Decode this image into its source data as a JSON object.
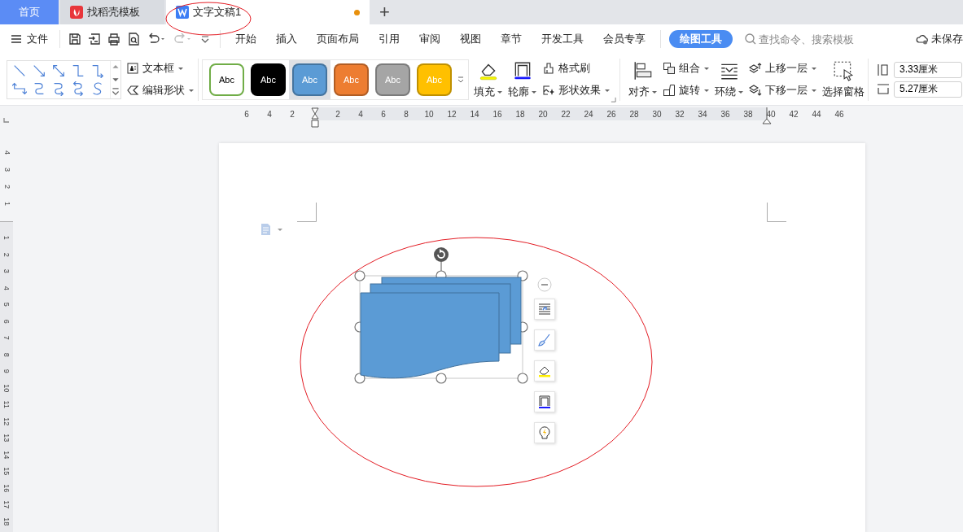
{
  "tabs": [
    {
      "label": "首页",
      "kind": "home",
      "selected": false
    },
    {
      "label": "找稻壳模板",
      "kind": "template",
      "selected": false
    },
    {
      "label": "文字文稿1",
      "kind": "document",
      "selected": true,
      "unsaved": true
    }
  ],
  "new_tab": "+",
  "menu": {
    "file": "文件",
    "tabs": [
      {
        "label": "开始",
        "selected": false
      },
      {
        "label": "插入",
        "selected": false
      },
      {
        "label": "页面布局",
        "selected": false
      },
      {
        "label": "引用",
        "selected": false
      },
      {
        "label": "审阅",
        "selected": false
      },
      {
        "label": "视图",
        "selected": false
      },
      {
        "label": "章节",
        "selected": false
      },
      {
        "label": "开发工具",
        "selected": false
      },
      {
        "label": "会员专享",
        "selected": false
      },
      {
        "label": "绘图工具",
        "selected": true
      }
    ],
    "search": {
      "placeholder": "查找命令、搜索模板"
    },
    "save_status": "未保存"
  },
  "ribbon": {
    "text_box": {
      "label": "文本框",
      "dropdown": true
    },
    "edit_shape": {
      "label": "编辑形状",
      "dropdown": true
    },
    "style_presets": [
      {
        "label": "Abc",
        "kind": "outline",
        "color": "#70ad47",
        "selected": false
      },
      {
        "label": "Abc",
        "kind": "filled",
        "color": "#000000",
        "selected": false
      },
      {
        "label": "Abc",
        "kind": "filled",
        "color": "#5b9bd5",
        "selected": true
      },
      {
        "label": "Abc",
        "kind": "filled",
        "color": "#ed7d31",
        "selected": false
      },
      {
        "label": "Abc",
        "kind": "filled",
        "color": "#a5a5a5",
        "selected": false
      },
      {
        "label": "Abc",
        "kind": "filled",
        "color": "#ffc000",
        "selected": false
      }
    ],
    "fill": {
      "label": "填充",
      "dropdown": true
    },
    "outline": {
      "label": "轮廓",
      "dropdown": true
    },
    "format_painter": {
      "label": "格式刷",
      "dropdown": false
    },
    "shape_effects": {
      "label": "形状效果",
      "dropdown": true
    },
    "align": {
      "label": "对齐",
      "dropdown": true
    },
    "group": {
      "label": "组合",
      "dropdown": true
    },
    "rotate": {
      "label": "旋转",
      "dropdown": true
    },
    "wrap": {
      "label": "环绕",
      "dropdown": true
    },
    "bring_forward": {
      "label": "上移一层",
      "dropdown": true
    },
    "send_backward": {
      "label": "下移一层",
      "dropdown": true
    },
    "selection_pane": {
      "label": "选择窗格",
      "dropdown": false
    },
    "height": {
      "value": "3.33厘米"
    },
    "width": {
      "value": "5.27厘米"
    }
  },
  "ruler": {
    "left_numbers": [
      "6",
      "4",
      "2"
    ],
    "right_numbers": [
      "2",
      "4",
      "6",
      "8",
      "10",
      "12",
      "14",
      "16",
      "18",
      "20",
      "22",
      "24",
      "26",
      "28",
      "30",
      "32",
      "34",
      "36",
      "38",
      "40",
      "42",
      "44",
      "46"
    ]
  },
  "vertical_ruler": {
    "top_numbers": [
      "4",
      "3",
      "2",
      "1"
    ],
    "body_numbers": [
      "1",
      "2",
      "3",
      "4",
      "5",
      "6",
      "7",
      "8",
      "9",
      "10",
      "11",
      "12",
      "13",
      "14",
      "15",
      "16",
      "17",
      "18"
    ]
  }
}
